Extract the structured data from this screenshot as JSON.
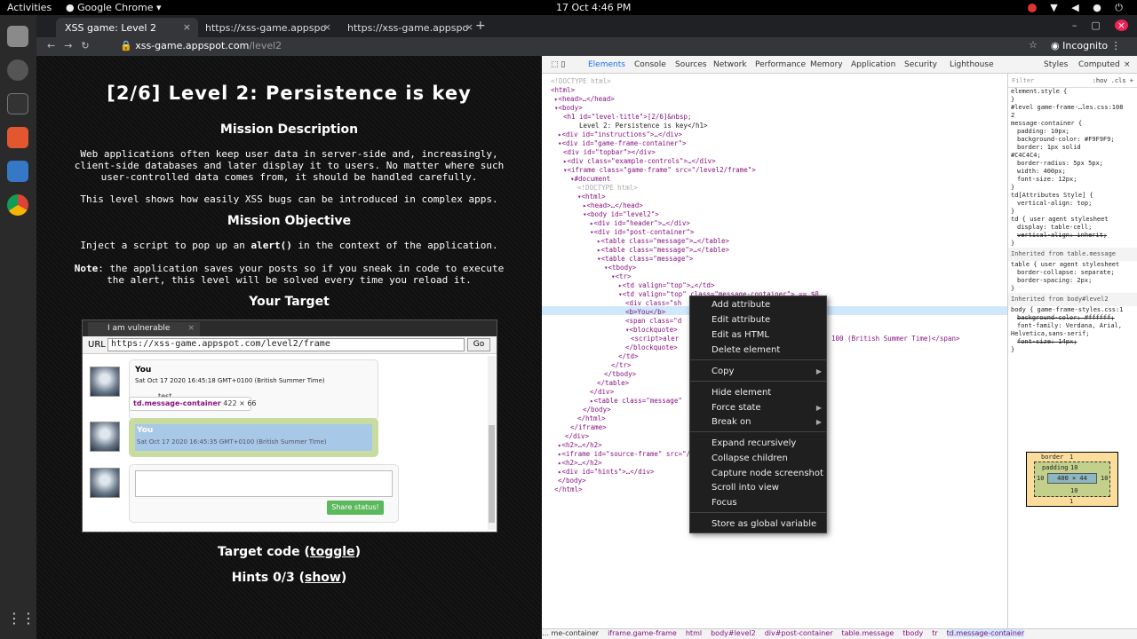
{
  "os": {
    "activities": "Activities",
    "app": "Google Chrome",
    "clock": "17 Oct  4:46 PM",
    "tray": "⚙ ▾ ◆ ▮ ⏻"
  },
  "tabs": [
    {
      "label": "XSS game: Level 2"
    },
    {
      "label": "https://xss-game.appspo"
    },
    {
      "label": "https://xss-game.appspo"
    }
  ],
  "toolbar": {
    "host": "xss-game.appspot.com",
    "path": "/level2",
    "incognito": "Incognito"
  },
  "page": {
    "title": "[2/6]  Level 2: Persistence is key",
    "mission_desc_h": "Mission Description",
    "desc1": "Web applications often keep user data in server-side and, increasingly,",
    "desc2": "client-side databases and later display it to users. No matter where such",
    "desc3": "user-controlled data comes from, it should be handled carefully.",
    "desc4": "This level shows how easily XSS bugs can be introduced in complex apps.",
    "objective_h": "Mission Objective",
    "obj_pre": "Inject a script to pop up an ",
    "obj_code": "alert()",
    "obj_post": " in the context of the application.",
    "note_b": "Note",
    "note1": ": the application saves your posts so if you sneak in code to execute",
    "note2": "the alert, this level will be solved every time you reload it.",
    "target_h": "Your Target",
    "target_code": "Target code (",
    "toggle": "toggle",
    "hints": "Hints 0/3 (",
    "show": "show",
    "close_paren": ")"
  },
  "frame": {
    "tab": "I am vulnerable",
    "url_label": "URL",
    "url": "https://xss-game.appspot.com/level2/frame",
    "go": "Go",
    "post1": {
      "name": "You",
      "date": "Sat Oct 17 2020 16:45:18 GMT+0100 (British Summer Time)",
      "text": "test"
    },
    "tooltip_tag": "td.message-container",
    "tooltip_size": "422 × 66",
    "post2": {
      "name": "You",
      "date": "Sat Oct 17 2020 16:45:35 GMT+0100 (British Summer Time)"
    },
    "share": "Share status!"
  },
  "devtools": {
    "tabs": [
      "Elements",
      "Console",
      "Sources",
      "Network",
      "Performance",
      "Memory",
      "Application",
      "Security",
      "Lighthouse"
    ],
    "styles_tabs": [
      "Styles",
      "Computed"
    ],
    "filter": "Filter",
    "hov": ":hov .cls +",
    "crumbs": [
      "… me-container",
      "iframe.game-frame",
      "html",
      "body#level2",
      "div#post-container",
      "table.message",
      "tbody",
      "tr",
      "td.message-container"
    ],
    "dom": [
      "<!DOCTYPE html>",
      "<html>",
      "▸<head>…</head>",
      "▾<body>",
      "<h1 id=\"level-title\">[2/6]&nbsp;",
      "Level 2: Persistence is key</h1>",
      "▸<div id=\"instructions\">…</div>",
      "▾<div id=\"game-frame-container\">",
      "<div id=\"topbar\"></div>",
      "▸<div class=\"example-controls\">…</div>",
      "▾<iframe class=\"game-frame\" src=\"/level2/frame\">",
      "▾#document",
      "<!DOCTYPE html>",
      "▾<html>",
      "▸<head>…</head>",
      "▾<body id=\"level2\">",
      "▸<div id=\"header\">…</div>",
      "▾<div id=\"post-container\">",
      "▸<table class=\"message\">…</table>",
      "▸<table class=\"message\">…</table>",
      "▾<table class=\"message\">",
      "▾<tbody>",
      "▾<tr>",
      "▸<td valign=\"top\">…</td>",
      "▾<td valign=\"top\" class=\"message-container\"> == $0",
      "<div class=\"sh",
      "<b>You</b>",
      "<span class=\"d",
      "▾<blockquote>",
      "<script>aler",
      "</blockquote>",
      "</td>",
      "</tr>",
      "</tbody>",
      "</table>",
      "</div>",
      "▸<table class=\"message\"",
      "</body>",
      "</html>",
      "</iframe>",
      "</div>",
      "▸<h2>…</h2>",
      "▸<iframe id=\"source-frame\" src=\"/",
      "▸<h2>…</h2>",
      "▸<div id=\"hints\">…</div>",
      "</body>",
      "</html>"
    ],
    "dom_extra": "100 (British Summer Time)</span>",
    "styles": [
      "element.style {",
      "}",
      "#level  game-frame-…les.css:108",
      "2",
      "message-container {",
      "padding: 10px;",
      "background-color: #F9F9F9;",
      "border: 1px solid",
      "#C4C4C4;",
      "border-radius: 5px 5px;",
      "width: 400px;",
      "font-size: 12px;",
      "}",
      "td[Attributes Style] {",
      "vertical-align: top;",
      "}",
      "td {    user agent stylesheet",
      "display: table-cell;",
      "vertical-align: inherit;",
      "}",
      "Inherited from table.message",
      "table {  user agent stylesheet",
      "border-collapse: separate;",
      "border-spacing: 2px;",
      "}",
      "Inherited from body#level2",
      "body {   game-frame-styles.css:1",
      "background-color: #ffffff;",
      "font-family: Verdana, Arial,",
      "Helvetica,sans-serif;",
      "font-size: 14px;",
      "}"
    ],
    "box": {
      "border": "border",
      "border_val": "1",
      "padding": "padding",
      "padding_val": "10",
      "content": "400 × 44",
      "side": "10"
    }
  },
  "context_menu": [
    {
      "label": "Add attribute"
    },
    {
      "label": "Edit attribute"
    },
    {
      "label": "Edit as HTML"
    },
    {
      "label": "Delete element"
    },
    {
      "label": "Copy",
      "sub": true
    },
    {
      "label": "Hide element"
    },
    {
      "label": "Force state",
      "sub": true
    },
    {
      "label": "Break on",
      "sub": true
    },
    {
      "label": "Expand recursively"
    },
    {
      "label": "Collapse children"
    },
    {
      "label": "Capture node screenshot"
    },
    {
      "label": "Scroll into view"
    },
    {
      "label": "Focus"
    },
    {
      "label": "Store as global variable"
    }
  ]
}
